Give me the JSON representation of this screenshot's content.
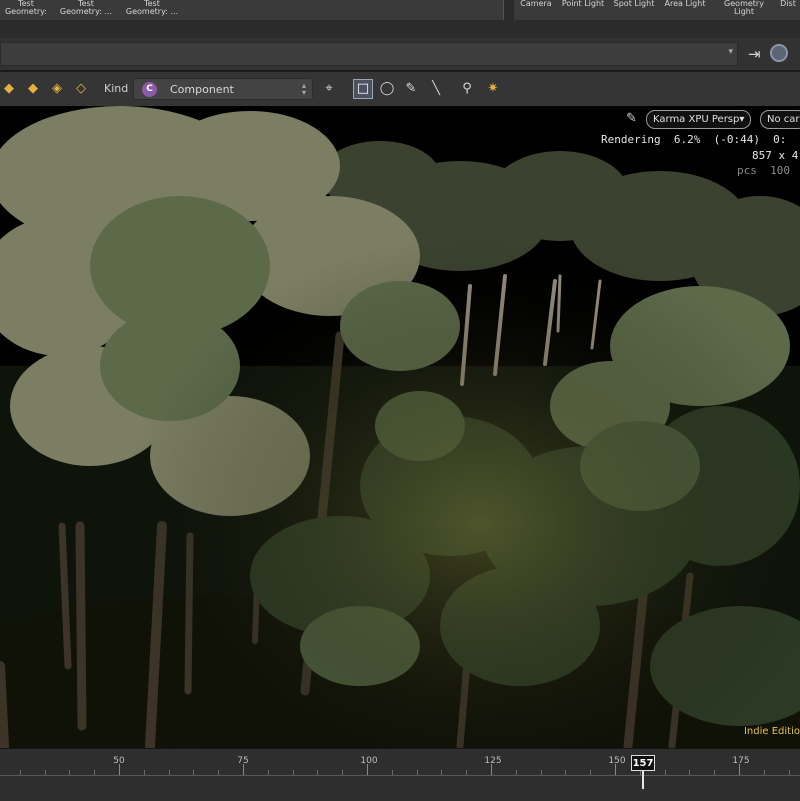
{
  "shelf": {
    "tools": [
      {
        "line1": "Test",
        "line2": "Geometry: ..."
      },
      {
        "line1": "Test",
        "line2": "Geometry: ..."
      },
      {
        "line1": "Test",
        "line2": "Geometry: ..."
      }
    ],
    "lights": [
      {
        "line1": "",
        "line2": "Camera"
      },
      {
        "line1": "",
        "line2": "Point Light"
      },
      {
        "line1": "",
        "line2": "Spot Light"
      },
      {
        "line1": "",
        "line2": "Area Light"
      },
      {
        "line1": "Geometry",
        "line2": "Light"
      },
      {
        "line1": "",
        "line2": "Dist"
      }
    ]
  },
  "toolbar": {
    "kind_label": "Kind",
    "kind_badge": "C",
    "kind_value": "Component"
  },
  "viewport": {
    "renderer": "Karma XPU  Persp▾",
    "camera": "No car",
    "rendering_line": "Rendering  6.2%  (-0:44)  0:",
    "resolution_line": "857 x 4",
    "samples_line": "pcs  100",
    "watermark": "Indie Editio"
  },
  "timeline": {
    "labels": [
      "50",
      "75",
      "100",
      "125",
      "150",
      "175"
    ],
    "current_frame": "157"
  },
  "colors": {
    "accent": "#e8c23c",
    "kind_badge": "#8b5aa8"
  },
  "icons": [
    "shelf-tool-icon",
    "pin-icon",
    "link-icon",
    "select-icon",
    "lasso-icon",
    "paint-icon",
    "brush-icon",
    "snap-icon",
    "camera-icon",
    "pencil-icon"
  ]
}
